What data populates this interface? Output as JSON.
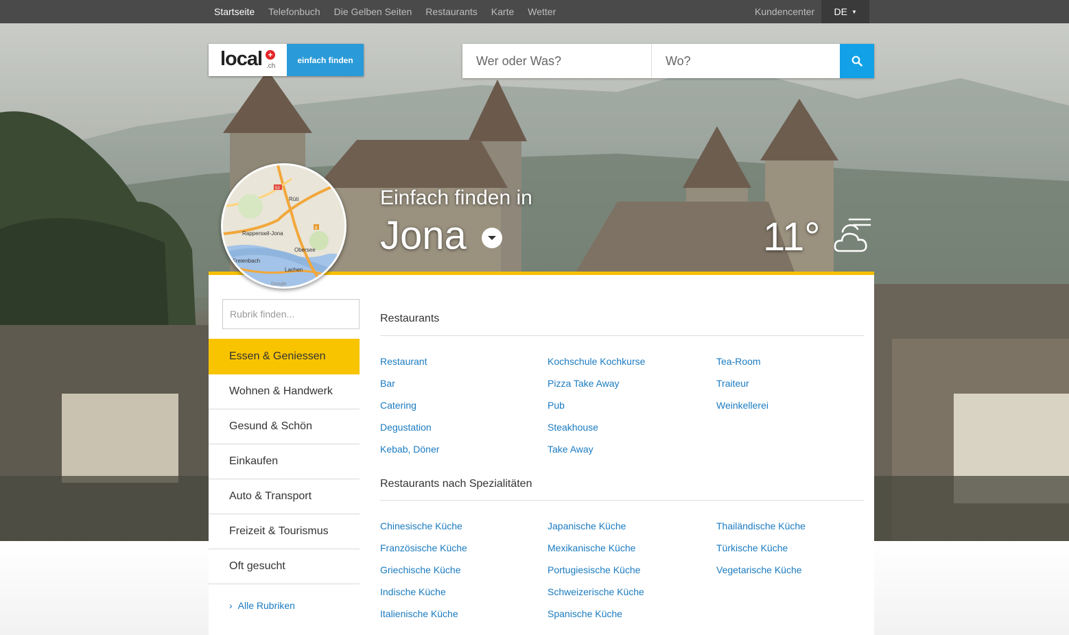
{
  "topnav": {
    "links": [
      "Startseite",
      "Telefonbuch",
      "Die Gelben Seiten",
      "Restaurants",
      "Karte",
      "Wetter"
    ],
    "customer_center": "Kundencenter",
    "language": "DE"
  },
  "logo": {
    "word": "local",
    "domain": ".ch",
    "tagline": "einfach finden"
  },
  "search": {
    "what_placeholder": "Wer oder Was?",
    "where_placeholder": "Wo?"
  },
  "map": {
    "labels": [
      "Rüti",
      "Rapperswil-Jona",
      "Obersee",
      "Freienbach",
      "Lachen",
      "53",
      "8",
      "Google"
    ]
  },
  "location": {
    "intro": "Einfach finden in",
    "city": "Jona"
  },
  "weather": {
    "temperature": "11°",
    "icon": "partly-cloudy-icon"
  },
  "sidebar": {
    "filter_placeholder": "Rubrik finden...",
    "categories": [
      "Essen & Geniessen",
      "Wohnen & Handwerk",
      "Gesund & Schön",
      "Einkaufen",
      "Auto & Transport",
      "Freizeit & Tourismus",
      "Oft gesucht"
    ],
    "all_link": "Alle Rubriken"
  },
  "sections": [
    {
      "title": "Restaurants",
      "columns": [
        [
          "Restaurant",
          "Bar",
          "Catering",
          "Degustation",
          "Kebab, Döner"
        ],
        [
          "Kochschule Kochkurse",
          "Pizza Take Away",
          "Pub",
          "Steakhouse",
          "Take Away"
        ],
        [
          "Tea-Room",
          "Traiteur",
          "Weinkellerei"
        ]
      ]
    },
    {
      "title": "Restaurants nach Spezialitäten",
      "columns": [
        [
          "Chinesische Küche",
          "Französische Küche",
          "Griechische Küche",
          "Indische Küche",
          "Italienische Küche"
        ],
        [
          "Japanische Küche",
          "Mexikanische Küche",
          "Portugiesische Küche",
          "Schweizerische Küche",
          "Spanische Küche"
        ],
        [
          "Thailändische Küche",
          "Türkische Küche",
          "Vegetarische Küche"
        ]
      ]
    }
  ],
  "colors": {
    "accent_yellow": "#f8c400",
    "link_blue": "#1a7bc0",
    "search_blue": "#12a1e6",
    "nav_bg": "#4a4a4a"
  }
}
